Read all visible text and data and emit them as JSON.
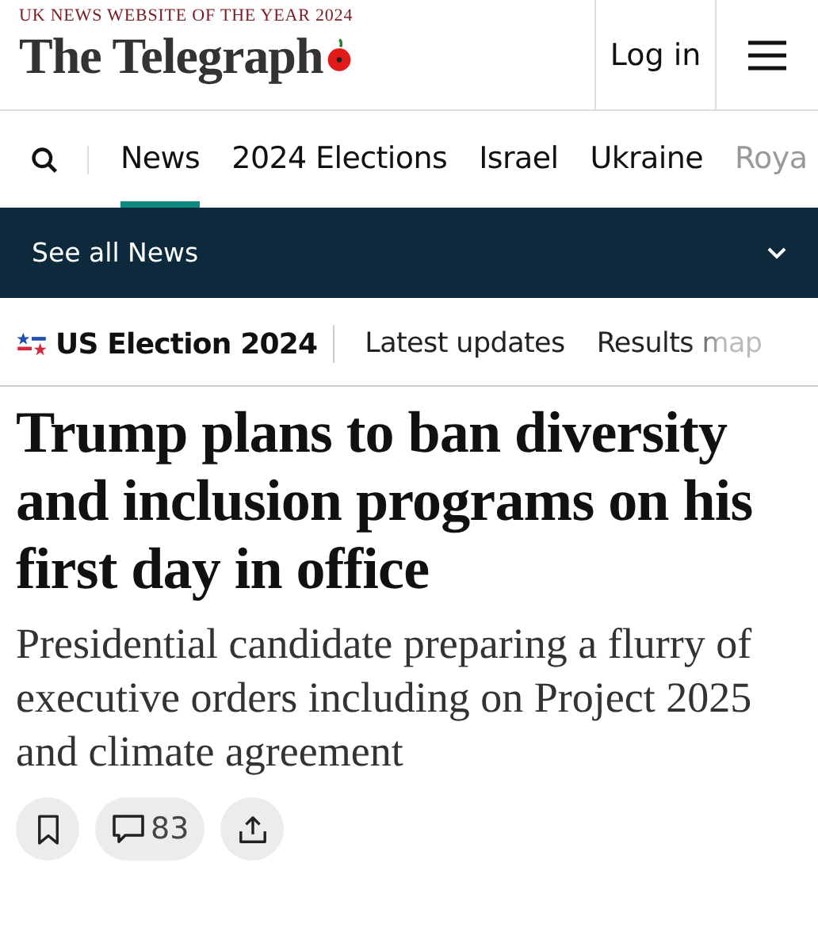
{
  "header": {
    "award": "UK NEWS WEBSITE OF THE YEAR 2024",
    "logo": "The Telegraph",
    "login": "Log in"
  },
  "nav": {
    "tabs": [
      {
        "label": "News",
        "selected": true
      },
      {
        "label": "2024 Elections",
        "selected": false
      },
      {
        "label": "Israel",
        "selected": false
      },
      {
        "label": "Ukraine",
        "selected": false
      },
      {
        "label": "Roya",
        "selected": false
      }
    ]
  },
  "section_bar": {
    "label": "See all News",
    "expanded": false
  },
  "topic_bar": {
    "title": "US Election 2024",
    "links": [
      "Latest updates",
      "Results map"
    ]
  },
  "article": {
    "headline": "Trump plans to ban diversity and inclusion programs on his first day in office",
    "standfirst": "Presidential candidate preparing a flurry of executive orders including on Project 2025 and climate agreement",
    "comment_count": "83"
  }
}
